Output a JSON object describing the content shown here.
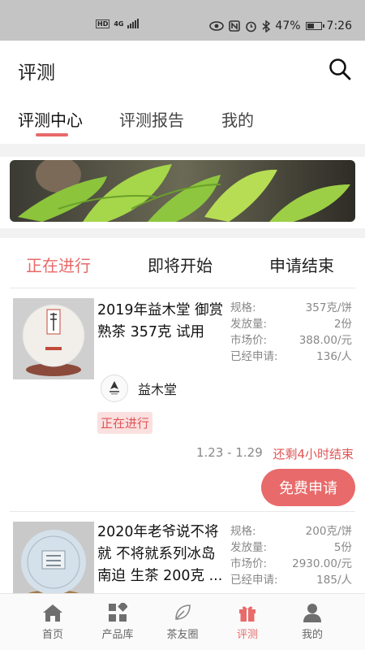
{
  "status_bar": {
    "battery": "47%",
    "time": "7:26",
    "network": "4G",
    "hd": "HD"
  },
  "header": {
    "title": "评测"
  },
  "tabs": [
    {
      "label": "评测中心",
      "active": true
    },
    {
      "label": "评测报告",
      "active": false
    },
    {
      "label": "我的",
      "active": false
    }
  ],
  "status_tabs": [
    {
      "label": "正在进行",
      "active": true
    },
    {
      "label": "即将开始",
      "active": false
    },
    {
      "label": "申请结束",
      "active": false
    }
  ],
  "products": [
    {
      "title": "2019年益木堂 御赏 熟茶 357克 试用",
      "brand": "益木堂",
      "status": "正在进行",
      "specs": [
        {
          "label": "规格:",
          "value": "357克/饼"
        },
        {
          "label": "发放量:",
          "value": "2份"
        },
        {
          "label": "市场价:",
          "value": "388.00/元"
        },
        {
          "label": "已经申请:",
          "value": "136/人"
        }
      ],
      "date_range": "1.23 - 1.29",
      "remaining": "还剩4小时结束",
      "apply_label": "免费申请"
    },
    {
      "title": "2020年老爷说不将就 不将就系列冰岛南迫 生茶 200克 ...",
      "specs": [
        {
          "label": "规格:",
          "value": "200克/饼"
        },
        {
          "label": "发放量:",
          "value": "5份"
        },
        {
          "label": "市场价:",
          "value": "2930.00/元"
        },
        {
          "label": "已经申请:",
          "value": "185/人"
        }
      ]
    }
  ],
  "bottom_nav": [
    {
      "label": "首页",
      "icon": "home-icon",
      "active": false
    },
    {
      "label": "产品库",
      "icon": "grid-icon",
      "active": false
    },
    {
      "label": "茶友圈",
      "icon": "leaf-icon",
      "active": false
    },
    {
      "label": "评测",
      "icon": "gift-icon",
      "active": true
    },
    {
      "label": "我的",
      "icon": "person-icon",
      "active": false
    }
  ],
  "colors": {
    "accent": "#e86a6a",
    "badge_bg": "#fbe0e0",
    "muted": "#888888"
  }
}
